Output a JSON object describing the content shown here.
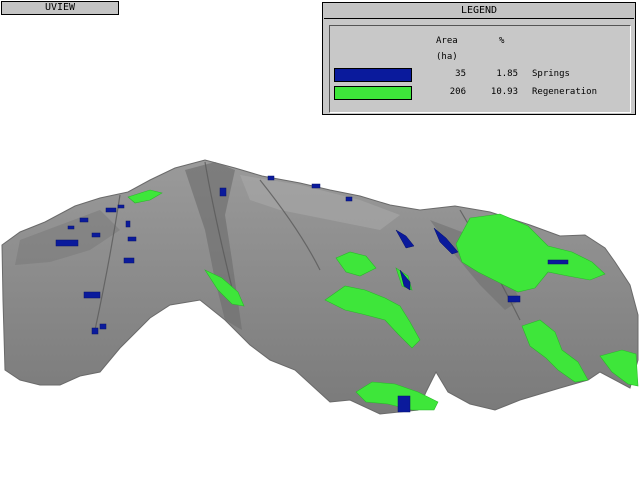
{
  "window": {
    "title": "UVIEW"
  },
  "legend": {
    "title": "LEGEND",
    "headers": {
      "area": "Area",
      "area_unit": "(ha)",
      "percent": "%"
    },
    "rows": [
      {
        "area": "35",
        "percent": "1.85",
        "label": "Springs",
        "color": "#0a1a9c"
      },
      {
        "area": "206",
        "percent": "10.93",
        "label": "Regeneration",
        "color": "#3ee63a"
      }
    ]
  },
  "colors": {
    "terrain": "#8c8c8c",
    "background": "#ffffff",
    "panel": "#c8c8c8"
  }
}
